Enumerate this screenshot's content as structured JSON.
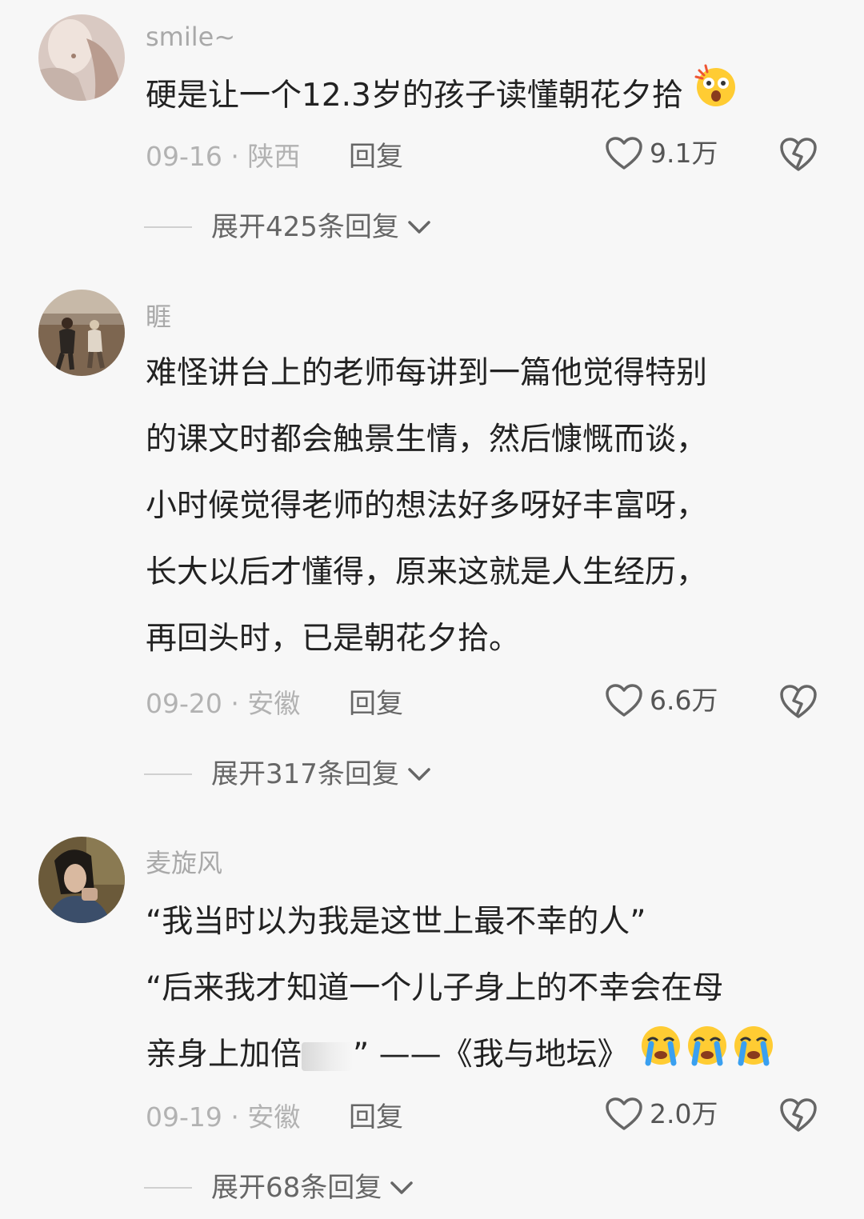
{
  "comments": [
    {
      "username": "smile~",
      "text_lines": [
        "硬是让一个12.3岁的孩子读懂朝花夕拾"
      ],
      "emoji": "shocked-face-emoji",
      "date_location": "09-16 · 陕西",
      "reply_label": "回复",
      "like_count": "9.1万",
      "expand_label": "展开425条回复"
    },
    {
      "username": "睚",
      "text_lines": [
        "难怪讲台上的老师每讲到一篇他觉得特别",
        "的课文时都会触景生情，然后慷慨而谈，",
        "小时候觉得老师的想法好多呀好丰富呀，",
        "长大以后才懂得，原来这就是人生经历，",
        "再回头时，已是朝花夕拾。"
      ],
      "date_location": "09-20 · 安徽",
      "reply_label": "回复",
      "like_count": "6.6万",
      "expand_label": "展开317条回复"
    },
    {
      "username": "麦旋风",
      "text_lines": [
        "“我当时以为我是这世上最不幸的人”",
        "“后来我才知道一个儿子身上的不幸会在母",
        "亲身上加倍",
        "” ——《我与地坛》"
      ],
      "emoji": "crying-face-emoji",
      "date_location": "09-19 · 安徽",
      "reply_label": "回复",
      "like_count": "2.0万",
      "expand_label": "展开68条回复"
    }
  ],
  "colors": {
    "background": "#f7f7f7",
    "text": "#222222",
    "muted": "#a9a9a9"
  }
}
